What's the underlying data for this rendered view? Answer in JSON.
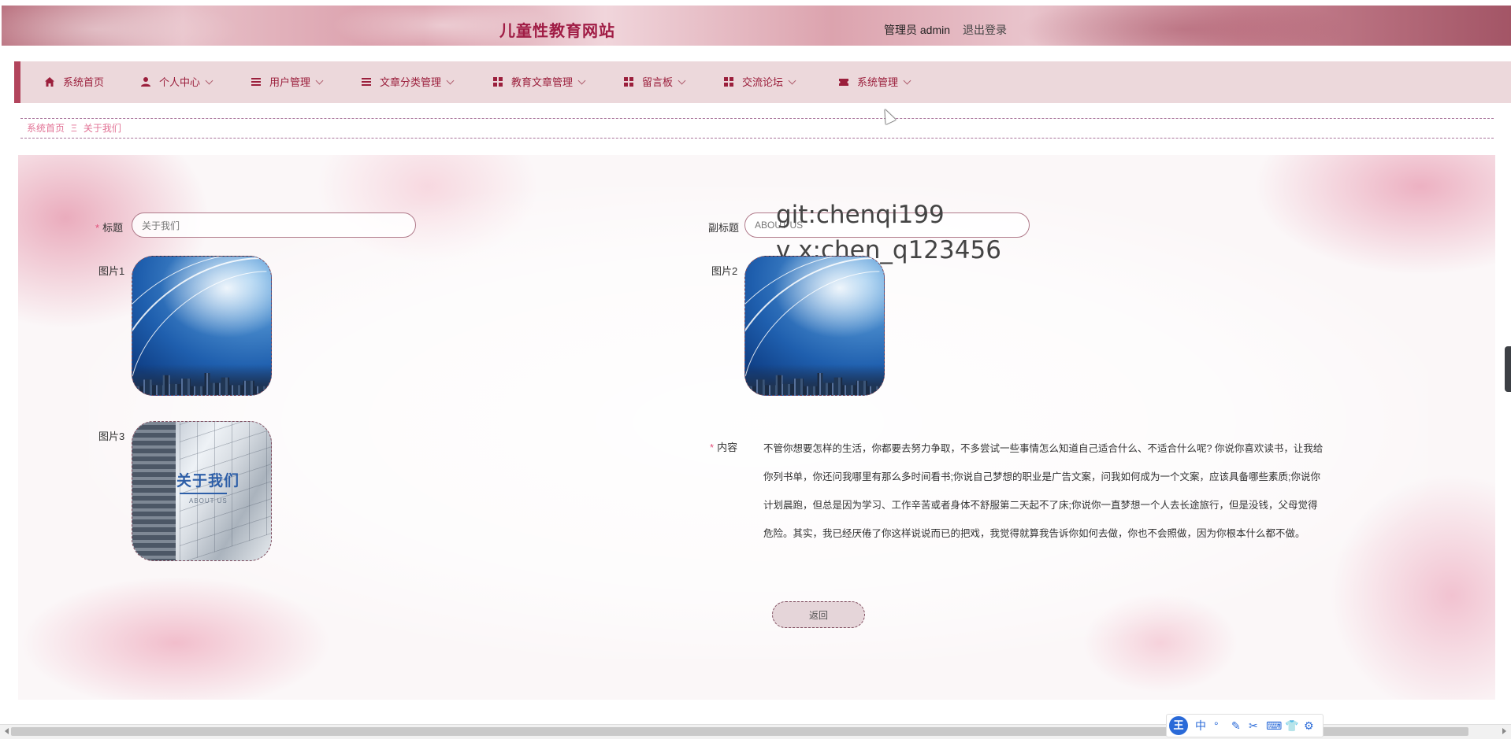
{
  "header": {
    "site_title": "儿童性教育网站",
    "admin_role": "管理员 admin",
    "logout": "退出登录"
  },
  "nav": {
    "items": [
      {
        "label": "系统首页",
        "icon": "home-icon",
        "dropdown": false
      },
      {
        "label": "个人中心",
        "icon": "user-icon",
        "dropdown": true
      },
      {
        "label": "用户管理",
        "icon": "list-icon",
        "dropdown": true
      },
      {
        "label": "文章分类管理",
        "icon": "list-icon",
        "dropdown": true
      },
      {
        "label": "教育文章管理",
        "icon": "grid-icon",
        "dropdown": true
      },
      {
        "label": "留言板",
        "icon": "grid-icon",
        "dropdown": true
      },
      {
        "label": "交流论坛",
        "icon": "grid-icon",
        "dropdown": true
      },
      {
        "label": "系统管理",
        "icon": "ticket-icon",
        "dropdown": true
      }
    ],
    "accent": "#9b1f3c"
  },
  "breadcrumb": {
    "home": "系统首页",
    "separator": "Ξ",
    "current": "关于我们"
  },
  "form": {
    "title_label": "标题",
    "title_value": "关于我们",
    "subtitle_label": "副标题",
    "subtitle_value": "ABOUT US",
    "image1_label": "图片1",
    "image2_label": "图片2",
    "image3_label": "图片3",
    "image3_caption_cn": "关于我们",
    "image3_caption_en": "ABOUT US",
    "content_label": "内容",
    "content": "不管你想要怎样的生活，你都要去努力争取，不多尝试一些事情怎么知道自己适合什么、不适合什么呢? 你说你喜欢读书，让我给你列书单，你还问我哪里有那么多时间看书;你说自己梦想的职业是广告文案，问我如何成为一个文案，应该具备哪些素质;你说你计划晨跑，但总是因为学习、工作辛苦或者身体不舒服第二天起不了床;你说你一直梦想一个人去长途旅行，但是没钱，父母觉得危险。其实，我已经厌倦了你这样说说而已的把戏，我觉得就算我告诉你如何去做，你也不会照做，因为你根本什么都不做。",
    "back_button": "返回",
    "required_mark": "*"
  },
  "watermark": {
    "line1": "git:chenqi199",
    "line2": "v x:chen_q123456"
  },
  "ime": {
    "logo": "王",
    "lang": "中",
    "buttons": [
      "°",
      "✎",
      "✂",
      "⌨",
      "👕",
      "⚙"
    ]
  },
  "colors": {
    "brand": "#a01c45",
    "nav_bg": "#ecd8db",
    "breadcrumb": "#e27396",
    "required": "#e2507a"
  }
}
